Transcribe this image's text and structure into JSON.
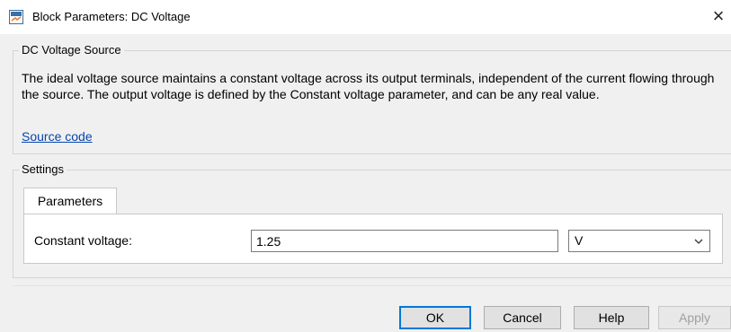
{
  "window": {
    "title": "Block Parameters: DC Voltage",
    "close_glyph": "×"
  },
  "block": {
    "name": "DC Voltage Source",
    "description": "The ideal voltage source maintains a constant voltage across its output terminals, independent of the current flowing through the source. The output voltage is defined by the Constant voltage parameter, and can be any real value.",
    "source_link": "Source code"
  },
  "settings": {
    "title": "Settings",
    "tabs": [
      {
        "label": "Parameters",
        "active": true
      }
    ],
    "parameters": [
      {
        "label": "Constant voltage:",
        "value": "1.25",
        "unit": "V"
      }
    ]
  },
  "buttons": {
    "ok": "OK",
    "cancel": "Cancel",
    "help": "Help",
    "apply": "Apply"
  },
  "icons": {
    "app": "simulink-block-icon",
    "close": "close-icon",
    "dropdown": "chevron-down-icon"
  },
  "colors": {
    "link": "#0645ad",
    "default_button_border": "#0078d7",
    "dialog_background": "#f0f0f0"
  }
}
